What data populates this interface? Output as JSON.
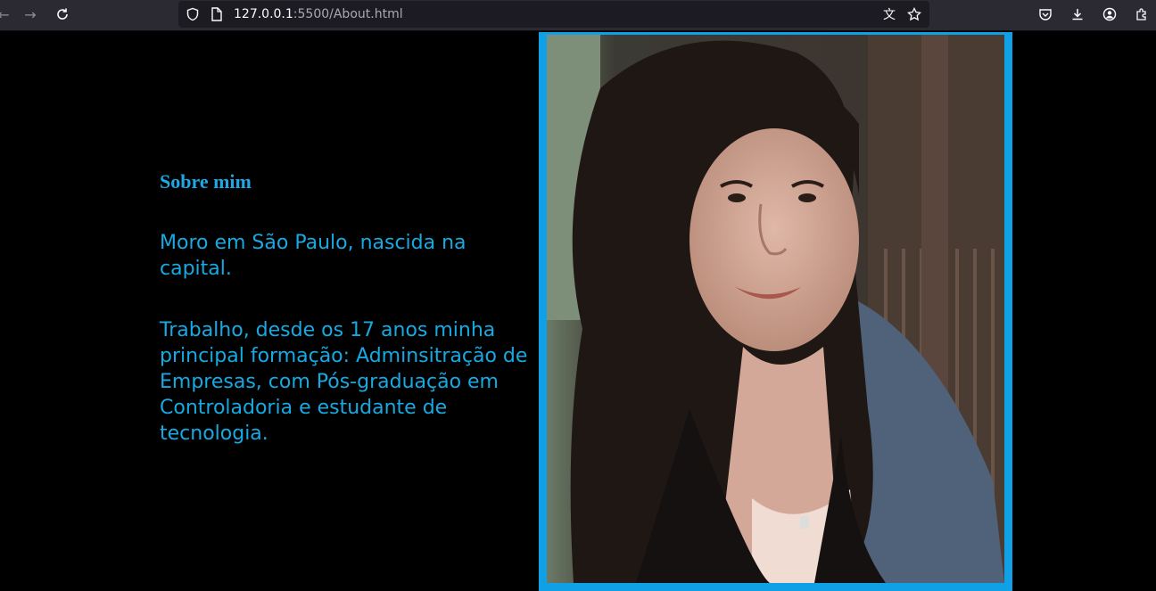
{
  "browser": {
    "url_host": "127.0.0.1",
    "url_rest": ":5500/About.html"
  },
  "about": {
    "heading": "Sobre mim",
    "paragraph1": "Moro em São Paulo, nascida na capital.",
    "paragraph2": "Trabalho, desde os 17 anos minha principal formação: Adminsitração de Empresas, com Pós-graduação em Controladoria e estudante de tecnologia."
  },
  "colors": {
    "text_accent": "#17a9e2",
    "frame_border": "#10a0e6",
    "background": "#000000"
  }
}
